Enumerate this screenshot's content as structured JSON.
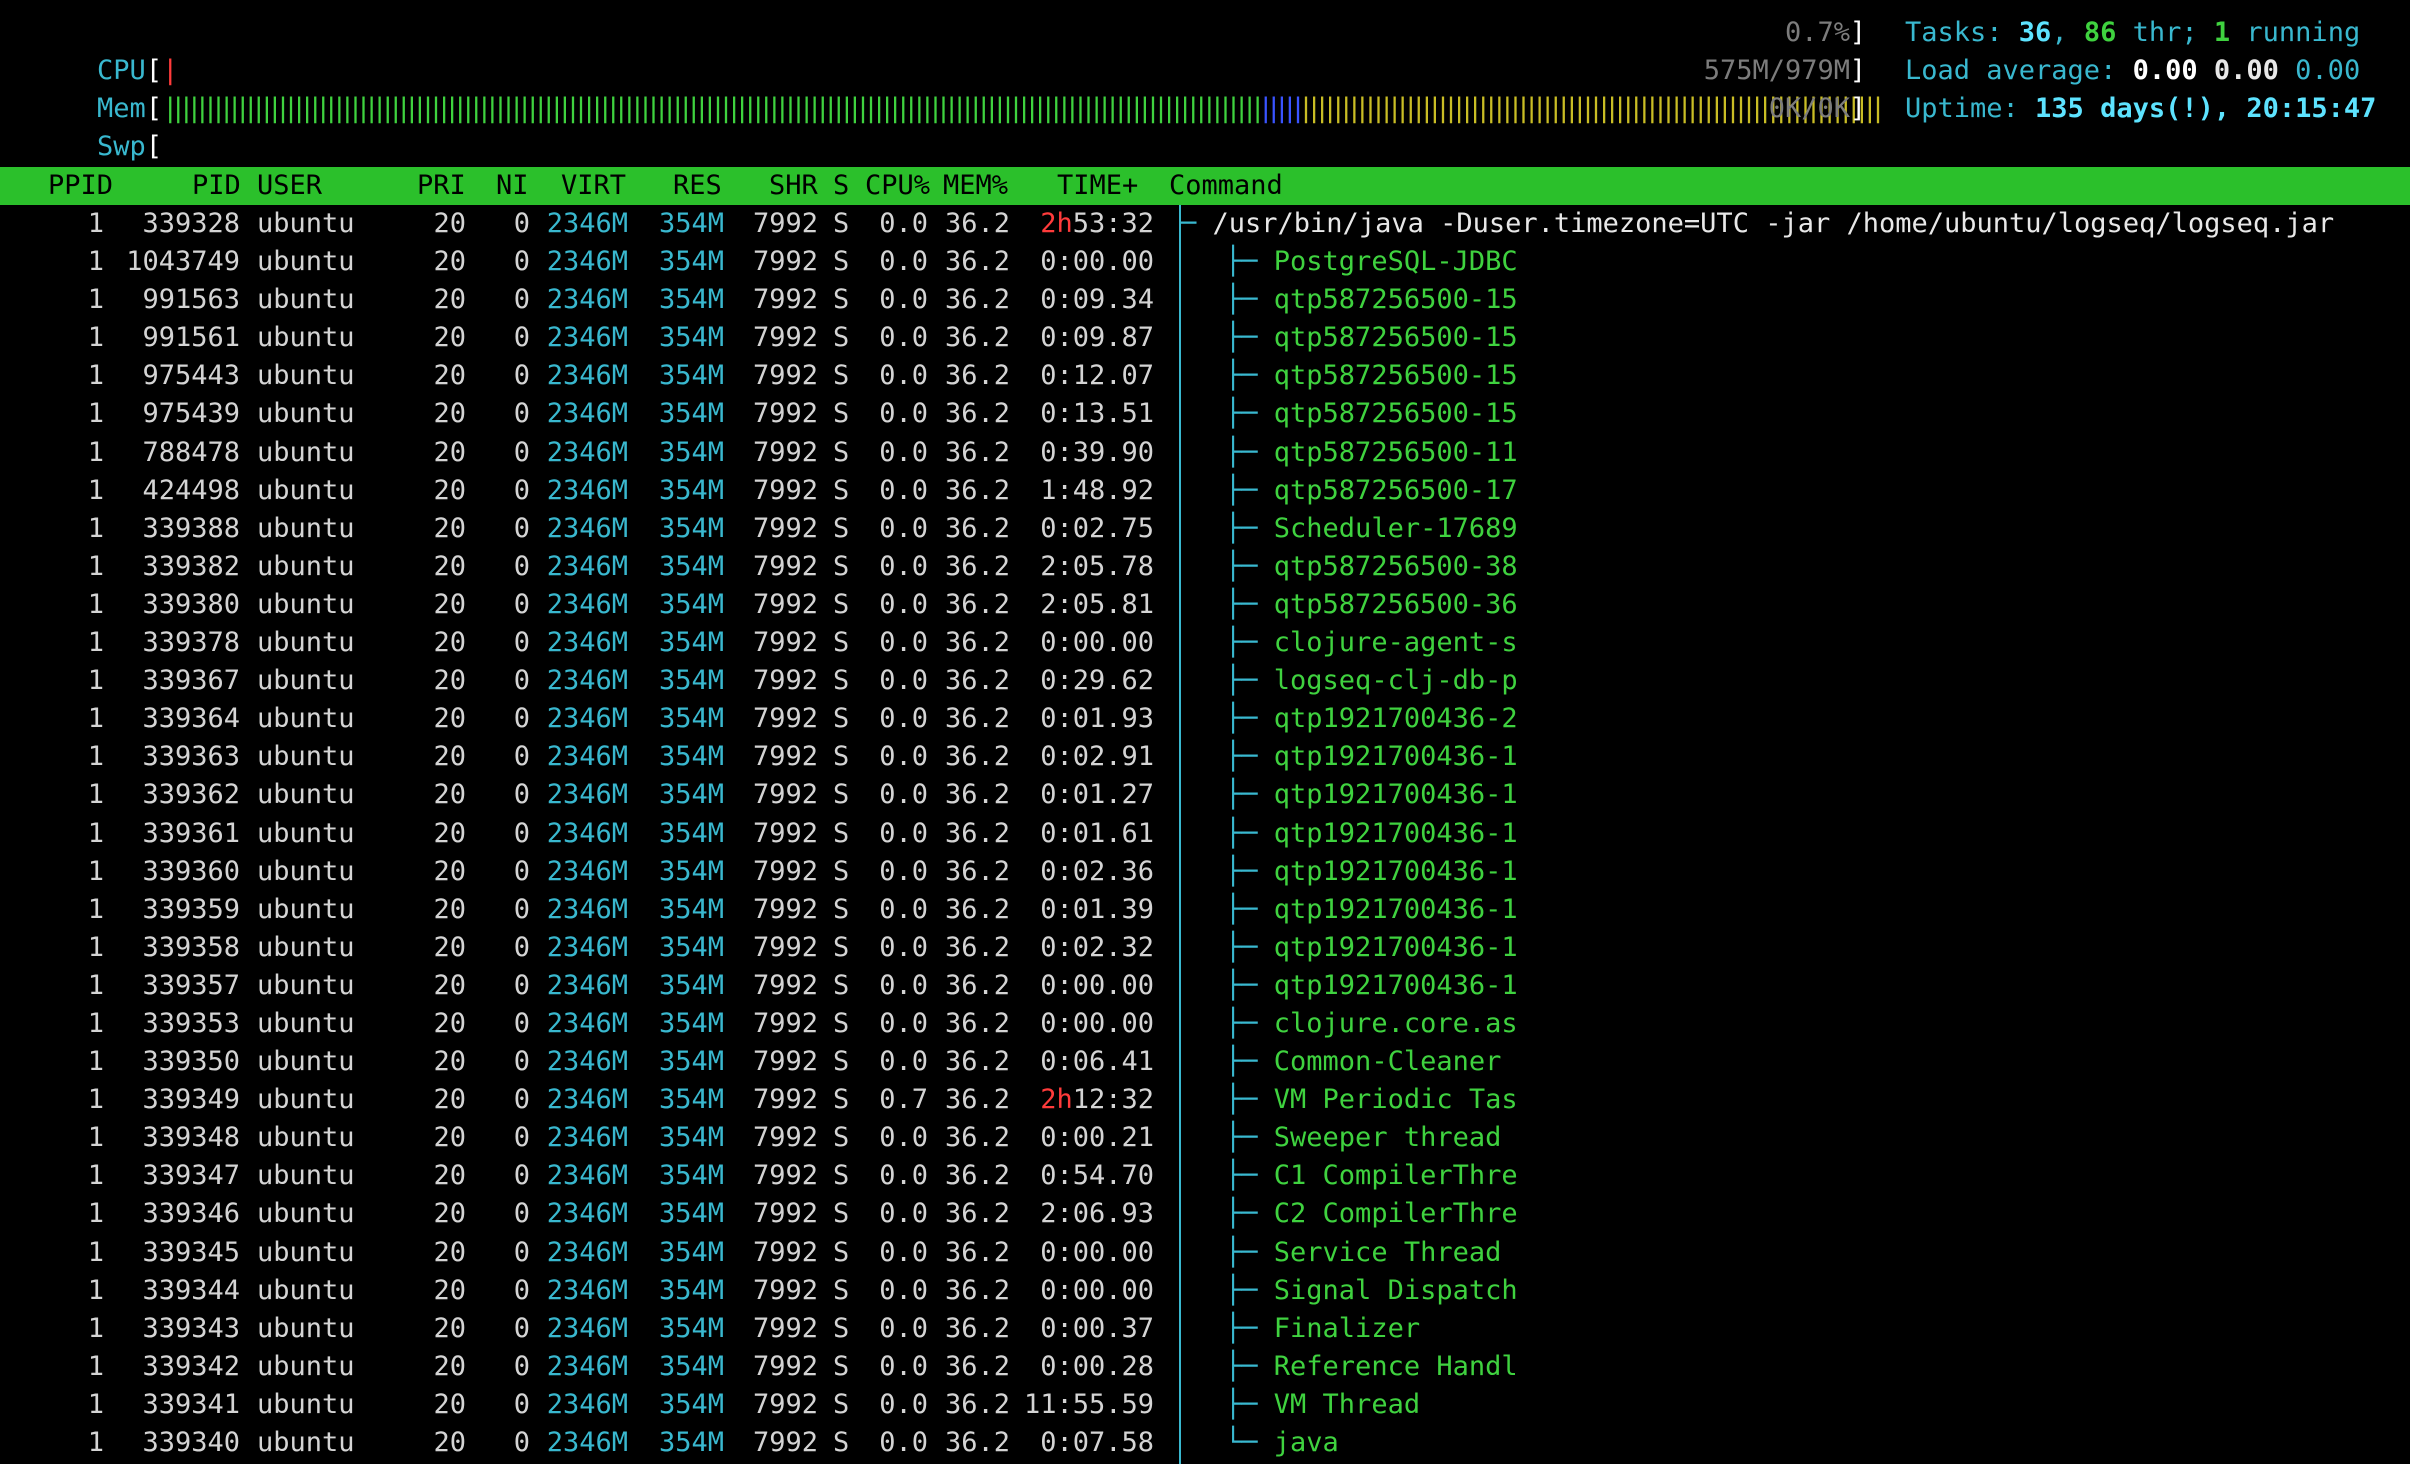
{
  "meters": {
    "cpu": {
      "label": "CPU",
      "bar": "|",
      "value": "0.7%"
    },
    "mem": {
      "label": "Mem",
      "bar_green": "||||||||||||||||||||||||||||||||||||||||||||||||||||||||||||||||||||||||||||||||||||||||||||||||||||||||||||||||||||||||||||||||||||||||",
      "bar_blue": "|||||",
      "bar_yellow": "||||||||||||||||||||||||||||||||||||||||||||||||||||||||||||||||||||||||",
      "value": "575M/979M"
    },
    "swp": {
      "label": "Swp",
      "value": "0K/0K"
    }
  },
  "summary": {
    "tasks_label": "Tasks: ",
    "tasks": "36",
    "thr": "86",
    "thr_label": " thr; ",
    "running": "1",
    "running_label": " running",
    "load_label": "Load average: ",
    "load1": "0.00",
    "load5": "0.00",
    "load15": "0.00",
    "uptime_label": "Uptime: ",
    "uptime": "135 days(!), 20:15:47"
  },
  "columns": {
    "ppid": "PPID",
    "pid": "PID",
    "user": "USER",
    "pri": "PRI",
    "ni": "NI",
    "virt": "VIRT",
    "res": "RES",
    "shr": "SHR",
    "s": "S",
    "cpu": "CPU%",
    "mem": "MEM%",
    "time": "TIME+",
    "command": "Command"
  },
  "colors": {
    "header_bg": "#2bc02b",
    "cyan": "#39b8cf",
    "green": "#3fd23f",
    "red": "#ff3b3b"
  },
  "processes": [
    {
      "ppid": "1",
      "pid": "339328",
      "user": "ubuntu",
      "pri": "20",
      "ni": "0",
      "virt": "2346M",
      "res": "354M",
      "shr": "7992",
      "s": "S",
      "cpu": "0.0",
      "mem": "36.2",
      "time_h": "2h",
      "time": "53:32",
      "tree": "─ ",
      "command": "/usr/bin/java -Duser.timezone=UTC -jar /home/ubuntu/logseq/logseq.jar",
      "main": true
    },
    {
      "ppid": "1",
      "pid": "1043749",
      "user": "ubuntu",
      "pri": "20",
      "ni": "0",
      "virt": "2346M",
      "res": "354M",
      "shr": "7992",
      "s": "S",
      "cpu": "0.0",
      "mem": "36.2",
      "time_h": "",
      "time": "0:00.00",
      "tree": "├─ ",
      "command": "PostgreSQL-JDBC"
    },
    {
      "ppid": "1",
      "pid": "991563",
      "user": "ubuntu",
      "pri": "20",
      "ni": "0",
      "virt": "2346M",
      "res": "354M",
      "shr": "7992",
      "s": "S",
      "cpu": "0.0",
      "mem": "36.2",
      "time_h": "",
      "time": "0:09.34",
      "tree": "├─ ",
      "command": "qtp587256500-15"
    },
    {
      "ppid": "1",
      "pid": "991561",
      "user": "ubuntu",
      "pri": "20",
      "ni": "0",
      "virt": "2346M",
      "res": "354M",
      "shr": "7992",
      "s": "S",
      "cpu": "0.0",
      "mem": "36.2",
      "time_h": "",
      "time": "0:09.87",
      "tree": "├─ ",
      "command": "qtp587256500-15"
    },
    {
      "ppid": "1",
      "pid": "975443",
      "user": "ubuntu",
      "pri": "20",
      "ni": "0",
      "virt": "2346M",
      "res": "354M",
      "shr": "7992",
      "s": "S",
      "cpu": "0.0",
      "mem": "36.2",
      "time_h": "",
      "time": "0:12.07",
      "tree": "├─ ",
      "command": "qtp587256500-15"
    },
    {
      "ppid": "1",
      "pid": "975439",
      "user": "ubuntu",
      "pri": "20",
      "ni": "0",
      "virt": "2346M",
      "res": "354M",
      "shr": "7992",
      "s": "S",
      "cpu": "0.0",
      "mem": "36.2",
      "time_h": "",
      "time": "0:13.51",
      "tree": "├─ ",
      "command": "qtp587256500-15"
    },
    {
      "ppid": "1",
      "pid": "788478",
      "user": "ubuntu",
      "pri": "20",
      "ni": "0",
      "virt": "2346M",
      "res": "354M",
      "shr": "7992",
      "s": "S",
      "cpu": "0.0",
      "mem": "36.2",
      "time_h": "",
      "time": "0:39.90",
      "tree": "├─ ",
      "command": "qtp587256500-11"
    },
    {
      "ppid": "1",
      "pid": "424498",
      "user": "ubuntu",
      "pri": "20",
      "ni": "0",
      "virt": "2346M",
      "res": "354M",
      "shr": "7992",
      "s": "S",
      "cpu": "0.0",
      "mem": "36.2",
      "time_h": "",
      "time": "1:48.92",
      "tree": "├─ ",
      "command": "qtp587256500-17"
    },
    {
      "ppid": "1",
      "pid": "339388",
      "user": "ubuntu",
      "pri": "20",
      "ni": "0",
      "virt": "2346M",
      "res": "354M",
      "shr": "7992",
      "s": "S",
      "cpu": "0.0",
      "mem": "36.2",
      "time_h": "",
      "time": "0:02.75",
      "tree": "├─ ",
      "command": "Scheduler-17689"
    },
    {
      "ppid": "1",
      "pid": "339382",
      "user": "ubuntu",
      "pri": "20",
      "ni": "0",
      "virt": "2346M",
      "res": "354M",
      "shr": "7992",
      "s": "S",
      "cpu": "0.0",
      "mem": "36.2",
      "time_h": "",
      "time": "2:05.78",
      "tree": "├─ ",
      "command": "qtp587256500-38"
    },
    {
      "ppid": "1",
      "pid": "339380",
      "user": "ubuntu",
      "pri": "20",
      "ni": "0",
      "virt": "2346M",
      "res": "354M",
      "shr": "7992",
      "s": "S",
      "cpu": "0.0",
      "mem": "36.2",
      "time_h": "",
      "time": "2:05.81",
      "tree": "├─ ",
      "command": "qtp587256500-36"
    },
    {
      "ppid": "1",
      "pid": "339378",
      "user": "ubuntu",
      "pri": "20",
      "ni": "0",
      "virt": "2346M",
      "res": "354M",
      "shr": "7992",
      "s": "S",
      "cpu": "0.0",
      "mem": "36.2",
      "time_h": "",
      "time": "0:00.00",
      "tree": "├─ ",
      "command": "clojure-agent-s"
    },
    {
      "ppid": "1",
      "pid": "339367",
      "user": "ubuntu",
      "pri": "20",
      "ni": "0",
      "virt": "2346M",
      "res": "354M",
      "shr": "7992",
      "s": "S",
      "cpu": "0.0",
      "mem": "36.2",
      "time_h": "",
      "time": "0:29.62",
      "tree": "├─ ",
      "command": "logseq-clj-db-p"
    },
    {
      "ppid": "1",
      "pid": "339364",
      "user": "ubuntu",
      "pri": "20",
      "ni": "0",
      "virt": "2346M",
      "res": "354M",
      "shr": "7992",
      "s": "S",
      "cpu": "0.0",
      "mem": "36.2",
      "time_h": "",
      "time": "0:01.93",
      "tree": "├─ ",
      "command": "qtp1921700436-2"
    },
    {
      "ppid": "1",
      "pid": "339363",
      "user": "ubuntu",
      "pri": "20",
      "ni": "0",
      "virt": "2346M",
      "res": "354M",
      "shr": "7992",
      "s": "S",
      "cpu": "0.0",
      "mem": "36.2",
      "time_h": "",
      "time": "0:02.91",
      "tree": "├─ ",
      "command": "qtp1921700436-1"
    },
    {
      "ppid": "1",
      "pid": "339362",
      "user": "ubuntu",
      "pri": "20",
      "ni": "0",
      "virt": "2346M",
      "res": "354M",
      "shr": "7992",
      "s": "S",
      "cpu": "0.0",
      "mem": "36.2",
      "time_h": "",
      "time": "0:01.27",
      "tree": "├─ ",
      "command": "qtp1921700436-1"
    },
    {
      "ppid": "1",
      "pid": "339361",
      "user": "ubuntu",
      "pri": "20",
      "ni": "0",
      "virt": "2346M",
      "res": "354M",
      "shr": "7992",
      "s": "S",
      "cpu": "0.0",
      "mem": "36.2",
      "time_h": "",
      "time": "0:01.61",
      "tree": "├─ ",
      "command": "qtp1921700436-1"
    },
    {
      "ppid": "1",
      "pid": "339360",
      "user": "ubuntu",
      "pri": "20",
      "ni": "0",
      "virt": "2346M",
      "res": "354M",
      "shr": "7992",
      "s": "S",
      "cpu": "0.0",
      "mem": "36.2",
      "time_h": "",
      "time": "0:02.36",
      "tree": "├─ ",
      "command": "qtp1921700436-1"
    },
    {
      "ppid": "1",
      "pid": "339359",
      "user": "ubuntu",
      "pri": "20",
      "ni": "0",
      "virt": "2346M",
      "res": "354M",
      "shr": "7992",
      "s": "S",
      "cpu": "0.0",
      "mem": "36.2",
      "time_h": "",
      "time": "0:01.39",
      "tree": "├─ ",
      "command": "qtp1921700436-1"
    },
    {
      "ppid": "1",
      "pid": "339358",
      "user": "ubuntu",
      "pri": "20",
      "ni": "0",
      "virt": "2346M",
      "res": "354M",
      "shr": "7992",
      "s": "S",
      "cpu": "0.0",
      "mem": "36.2",
      "time_h": "",
      "time": "0:02.32",
      "tree": "├─ ",
      "command": "qtp1921700436-1"
    },
    {
      "ppid": "1",
      "pid": "339357",
      "user": "ubuntu",
      "pri": "20",
      "ni": "0",
      "virt": "2346M",
      "res": "354M",
      "shr": "7992",
      "s": "S",
      "cpu": "0.0",
      "mem": "36.2",
      "time_h": "",
      "time": "0:00.00",
      "tree": "├─ ",
      "command": "qtp1921700436-1"
    },
    {
      "ppid": "1",
      "pid": "339353",
      "user": "ubuntu",
      "pri": "20",
      "ni": "0",
      "virt": "2346M",
      "res": "354M",
      "shr": "7992",
      "s": "S",
      "cpu": "0.0",
      "mem": "36.2",
      "time_h": "",
      "time": "0:00.00",
      "tree": "├─ ",
      "command": "clojure.core.as"
    },
    {
      "ppid": "1",
      "pid": "339350",
      "user": "ubuntu",
      "pri": "20",
      "ni": "0",
      "virt": "2346M",
      "res": "354M",
      "shr": "7992",
      "s": "S",
      "cpu": "0.0",
      "mem": "36.2",
      "time_h": "",
      "time": "0:06.41",
      "tree": "├─ ",
      "command": "Common-Cleaner"
    },
    {
      "ppid": "1",
      "pid": "339349",
      "user": "ubuntu",
      "pri": "20",
      "ni": "0",
      "virt": "2346M",
      "res": "354M",
      "shr": "7992",
      "s": "S",
      "cpu": "0.7",
      "mem": "36.2",
      "time_h": "2h",
      "time": "12:32",
      "tree": "├─ ",
      "command": "VM Periodic Tas"
    },
    {
      "ppid": "1",
      "pid": "339348",
      "user": "ubuntu",
      "pri": "20",
      "ni": "0",
      "virt": "2346M",
      "res": "354M",
      "shr": "7992",
      "s": "S",
      "cpu": "0.0",
      "mem": "36.2",
      "time_h": "",
      "time": "0:00.21",
      "tree": "├─ ",
      "command": "Sweeper thread"
    },
    {
      "ppid": "1",
      "pid": "339347",
      "user": "ubuntu",
      "pri": "20",
      "ni": "0",
      "virt": "2346M",
      "res": "354M",
      "shr": "7992",
      "s": "S",
      "cpu": "0.0",
      "mem": "36.2",
      "time_h": "",
      "time": "0:54.70",
      "tree": "├─ ",
      "command": "C1 CompilerThre"
    },
    {
      "ppid": "1",
      "pid": "339346",
      "user": "ubuntu",
      "pri": "20",
      "ni": "0",
      "virt": "2346M",
      "res": "354M",
      "shr": "7992",
      "s": "S",
      "cpu": "0.0",
      "mem": "36.2",
      "time_h": "",
      "time": "2:06.93",
      "tree": "├─ ",
      "command": "C2 CompilerThre"
    },
    {
      "ppid": "1",
      "pid": "339345",
      "user": "ubuntu",
      "pri": "20",
      "ni": "0",
      "virt": "2346M",
      "res": "354M",
      "shr": "7992",
      "s": "S",
      "cpu": "0.0",
      "mem": "36.2",
      "time_h": "",
      "time": "0:00.00",
      "tree": "├─ ",
      "command": "Service Thread"
    },
    {
      "ppid": "1",
      "pid": "339344",
      "user": "ubuntu",
      "pri": "20",
      "ni": "0",
      "virt": "2346M",
      "res": "354M",
      "shr": "7992",
      "s": "S",
      "cpu": "0.0",
      "mem": "36.2",
      "time_h": "",
      "time": "0:00.00",
      "tree": "├─ ",
      "command": "Signal Dispatch"
    },
    {
      "ppid": "1",
      "pid": "339343",
      "user": "ubuntu",
      "pri": "20",
      "ni": "0",
      "virt": "2346M",
      "res": "354M",
      "shr": "7992",
      "s": "S",
      "cpu": "0.0",
      "mem": "36.2",
      "time_h": "",
      "time": "0:00.37",
      "tree": "├─ ",
      "command": "Finalizer"
    },
    {
      "ppid": "1",
      "pid": "339342",
      "user": "ubuntu",
      "pri": "20",
      "ni": "0",
      "virt": "2346M",
      "res": "354M",
      "shr": "7992",
      "s": "S",
      "cpu": "0.0",
      "mem": "36.2",
      "time_h": "",
      "time": "0:00.28",
      "tree": "├─ ",
      "command": "Reference Handl"
    },
    {
      "ppid": "1",
      "pid": "339341",
      "user": "ubuntu",
      "pri": "20",
      "ni": "0",
      "virt": "2346M",
      "res": "354M",
      "shr": "7992",
      "s": "S",
      "cpu": "0.0",
      "mem": "36.2",
      "time_h": "",
      "time": "11:55.59",
      "tree": "├─ ",
      "command": "VM Thread"
    },
    {
      "ppid": "1",
      "pid": "339340",
      "user": "ubuntu",
      "pri": "20",
      "ni": "0",
      "virt": "2346M",
      "res": "354M",
      "shr": "7992",
      "s": "S",
      "cpu": "0.0",
      "mem": "36.2",
      "time_h": "",
      "time": "0:07.58",
      "tree": "└─ ",
      "command": "java"
    }
  ]
}
